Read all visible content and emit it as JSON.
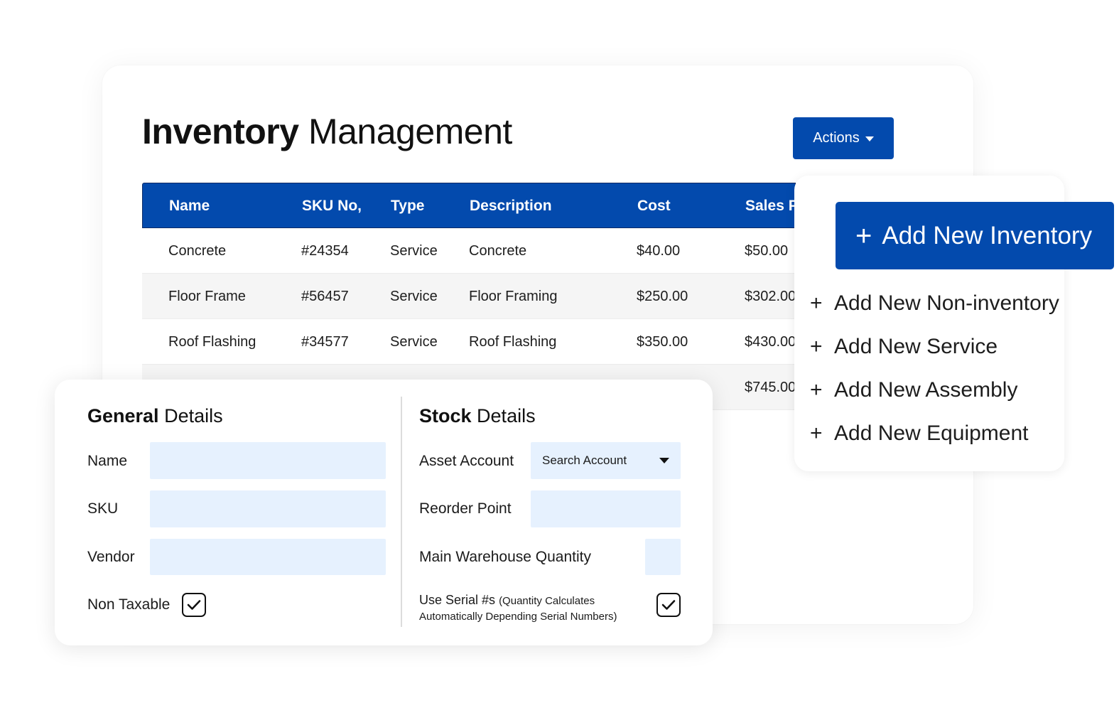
{
  "page": {
    "title_bold": "Inventory",
    "title_light": "Management",
    "actions_label": "Actions"
  },
  "colors": {
    "primary": "#034aad",
    "field_bg": "#e6f1fe"
  },
  "table": {
    "headers": {
      "name": "Name",
      "sku": "SKU No,",
      "type": "Type",
      "description": "Description",
      "cost": "Cost",
      "sales": "Sales P"
    },
    "rows": [
      {
        "name": "Concrete",
        "sku": "#24354",
        "type": "Service",
        "description": "Concrete",
        "cost": "$40.00",
        "sales": "$50.00"
      },
      {
        "name": "Floor Frame",
        "sku": "#56457",
        "type": "Service",
        "description": "Floor Framing",
        "cost": "$250.00",
        "sales": "$302.00"
      },
      {
        "name": "Roof Flashing",
        "sku": "#34577",
        "type": "Service",
        "description": "Roof Flashing",
        "cost": "$350.00",
        "sales": "$430.00"
      },
      {
        "name": "",
        "sku": "",
        "type": "",
        "description": "",
        "cost": "",
        "sales": "$745.00"
      }
    ]
  },
  "actions_menu": {
    "primary": "Add New Inventory",
    "items": [
      "Add New Non-inventory",
      "Add New Service",
      "Add New Assembly",
      "Add New Equipment"
    ]
  },
  "general_details": {
    "title_bold": "General",
    "title_light": "Details",
    "name_label": "Name",
    "sku_label": "SKU",
    "vendor_label": "Vendor",
    "non_taxable_label": "Non Taxable",
    "non_taxable_checked": true
  },
  "stock_details": {
    "title_bold": "Stock",
    "title_light": "Details",
    "asset_account_label": "Asset Account",
    "asset_account_placeholder": "Search Account",
    "reorder_point_label": "Reorder Point",
    "main_warehouse_label": "Main Warehouse Quantity",
    "serial_label": "Use Serial #s",
    "serial_note_line1": "(Quantity Calculates",
    "serial_note_line2": "Automatically Depending Serial Numbers)",
    "serial_checked": true
  }
}
